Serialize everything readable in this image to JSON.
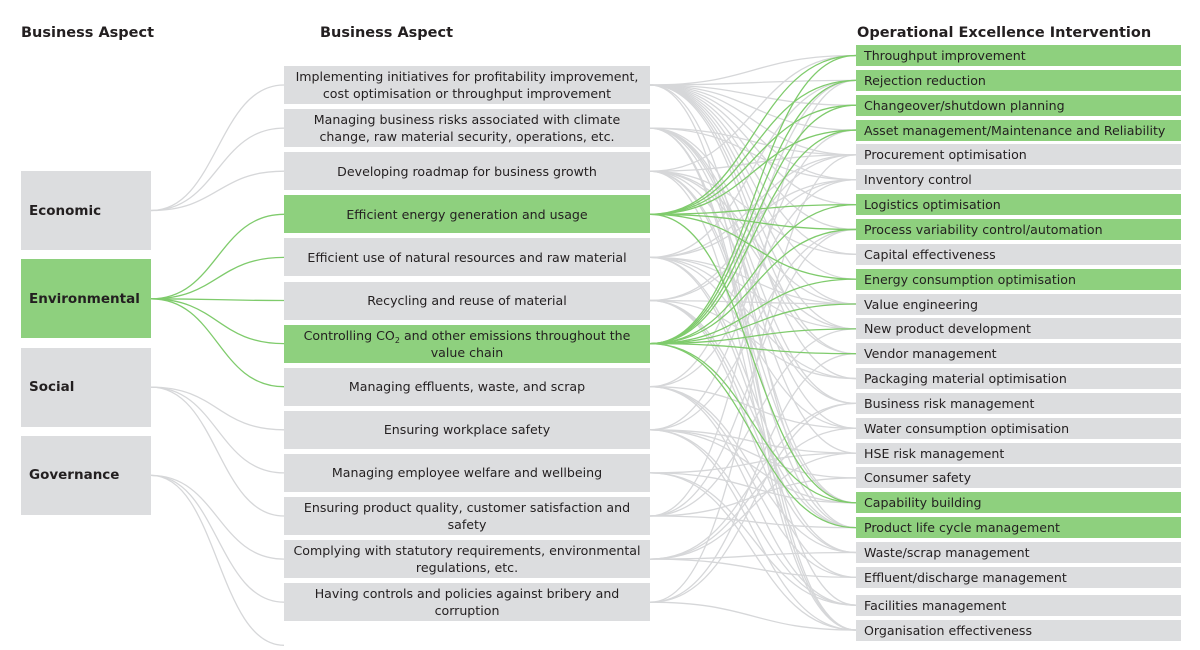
{
  "headers": {
    "left": "Business Aspect",
    "middle": "Business Aspect",
    "right": "Operational Excellence Intervention"
  },
  "colors": {
    "highlight": "#8ed07e",
    "box": "#dcdddf",
    "link_gray": "#d6d7d9",
    "link_green": "#7fcb6c"
  },
  "pillars": [
    {
      "label": "Economic",
      "highlighted": false,
      "links": [
        0,
        1,
        2
      ]
    },
    {
      "label": "Environmental",
      "highlighted": true,
      "links": [
        3,
        4,
        5,
        6,
        7
      ]
    },
    {
      "label": "Social",
      "highlighted": false,
      "links": [
        8,
        9,
        10
      ]
    },
    {
      "label": "Governance",
      "highlighted": false,
      "links": [
        11,
        12,
        13
      ]
    }
  ],
  "aspects": [
    {
      "label": "Implementing initiatives for profitability improvement, cost optimisation or throughput improvement",
      "highlighted": false
    },
    {
      "label": "Managing business risks associated with climate change, raw material security, operations, etc.",
      "highlighted": false
    },
    {
      "label": "Developing roadmap for business growth",
      "highlighted": false
    },
    {
      "label": "Efficient energy generation and usage",
      "highlighted": true
    },
    {
      "label": "Efficient use of natural resources and raw material",
      "highlighted": false
    },
    {
      "label": "Recycling and reuse of material",
      "highlighted": false
    },
    {
      "label": "Controlling CO",
      "label_sub": "2",
      "label_rest": " and other emissions throughout the value chain",
      "highlighted": true
    },
    {
      "label": "Managing effluents, waste, and scrap",
      "highlighted": false
    },
    {
      "label": "Ensuring workplace safety",
      "highlighted": false
    },
    {
      "label": "Managing employee welfare and wellbeing",
      "highlighted": false
    },
    {
      "label": "Ensuring product quality, customer satisfaction and safety",
      "highlighted": false
    },
    {
      "label": "Complying with statutory requirements, environmental regulations, etc.",
      "highlighted": false
    },
    {
      "label": "Having controls and policies against bribery and corruption",
      "highlighted": false
    }
  ],
  "interventions": [
    {
      "label": "Throughput improvement",
      "highlighted": true
    },
    {
      "label": "Rejection reduction",
      "highlighted": true
    },
    {
      "label": "Changeover/shutdown planning",
      "highlighted": true
    },
    {
      "label": "Asset management/Maintenance and Reliability",
      "highlighted": true
    },
    {
      "label": "Procurement optimisation",
      "highlighted": false
    },
    {
      "label": "Inventory control",
      "highlighted": false
    },
    {
      "label": "Logistics optimisation",
      "highlighted": true
    },
    {
      "label": "Process variability control/automation",
      "highlighted": true
    },
    {
      "label": "Capital effectiveness",
      "highlighted": false
    },
    {
      "label": "Energy consumption optimisation",
      "highlighted": true
    },
    {
      "label": "Value engineering",
      "highlighted": false
    },
    {
      "label": "New product development",
      "highlighted": false
    },
    {
      "label": "Vendor management",
      "highlighted": false
    },
    {
      "label": "Packaging material optimisation",
      "highlighted": false
    },
    {
      "label": "Business risk management",
      "highlighted": false
    },
    {
      "label": "Water consumption optimisation",
      "highlighted": false
    },
    {
      "label": "HSE risk management",
      "highlighted": false
    },
    {
      "label": "Consumer safety",
      "highlighted": false
    },
    {
      "label": "Capability building",
      "highlighted": true
    },
    {
      "label": "Product life cycle management",
      "highlighted": true
    },
    {
      "label": "Waste/scrap management",
      "highlighted": false
    },
    {
      "label": "Effluent/discharge management",
      "highlighted": false
    },
    {
      "label": "Facilities management",
      "highlighted": false
    },
    {
      "label": "Organisation effectiveness",
      "highlighted": false
    }
  ],
  "aspect_links": [
    [
      0,
      1,
      2,
      3,
      4,
      5,
      6,
      7,
      8,
      9,
      10,
      11,
      12,
      13,
      19,
      23
    ],
    [
      4,
      5,
      12,
      14,
      15,
      16,
      18,
      22,
      23
    ],
    [
      0,
      4,
      8,
      10,
      11,
      14,
      18,
      19,
      23
    ],
    [
      0,
      1,
      2,
      3,
      6,
      7,
      9,
      18
    ],
    [
      1,
      4,
      5,
      10,
      11,
      13,
      15,
      19,
      20
    ],
    [
      4,
      5,
      10,
      13,
      19,
      20,
      21
    ],
    [
      0,
      1,
      2,
      3,
      6,
      7,
      9,
      10,
      11,
      12,
      18,
      19
    ],
    [
      1,
      5,
      15,
      20,
      21,
      22
    ],
    [
      3,
      7,
      16,
      17,
      18,
      22,
      23
    ],
    [
      16,
      18,
      22,
      23
    ],
    [
      1,
      7,
      11,
      17,
      19
    ],
    [
      14,
      15,
      16,
      20,
      21
    ],
    [
      4,
      12,
      14,
      23
    ]
  ]
}
